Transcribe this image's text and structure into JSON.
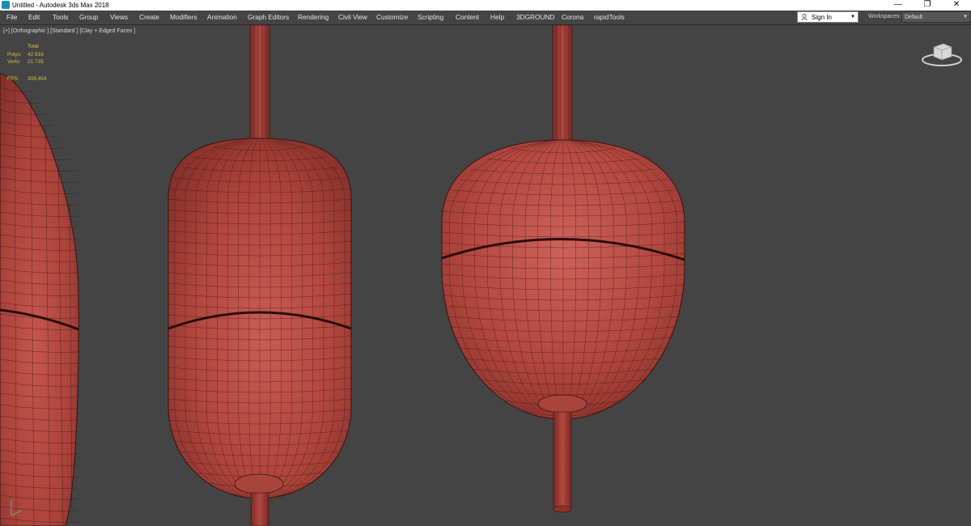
{
  "window": {
    "title": "Untitled - Autodesk 3ds Max 2018",
    "icon": "3ds-max-icon",
    "controls": [
      "minimize-icon",
      "restore-icon",
      "close-icon"
    ]
  },
  "menu": {
    "items": [
      "File",
      "Edit",
      "Tools",
      "Group",
      "Views",
      "Create",
      "Modifiers",
      "Animation",
      "Graph Editors",
      "Rendering",
      "Civil View",
      "Customize",
      "Scripting",
      "Content",
      "Help",
      "3DGROUND",
      "Corona",
      "rapidTools"
    ]
  },
  "account": {
    "sign_in": "Sign In",
    "icon": "user-icon"
  },
  "workspaces": {
    "label": "Workspaces:",
    "value": "Default"
  },
  "viewport": {
    "label": "[+] [Orthographic ] [Standard ] [Clay + Edged Faces ]",
    "stats": {
      "total_label": "Total",
      "polys_label": "Polys:",
      "polys_value": "42 816",
      "verts_label": "Verts:",
      "verts_value": "21 735",
      "fps_label": "FPS:",
      "fps_value": "309,454"
    },
    "colors": {
      "background": "#444444",
      "clay": "#b5473f",
      "wire": "#3a1210",
      "stats_text": "#d4c23a"
    }
  }
}
